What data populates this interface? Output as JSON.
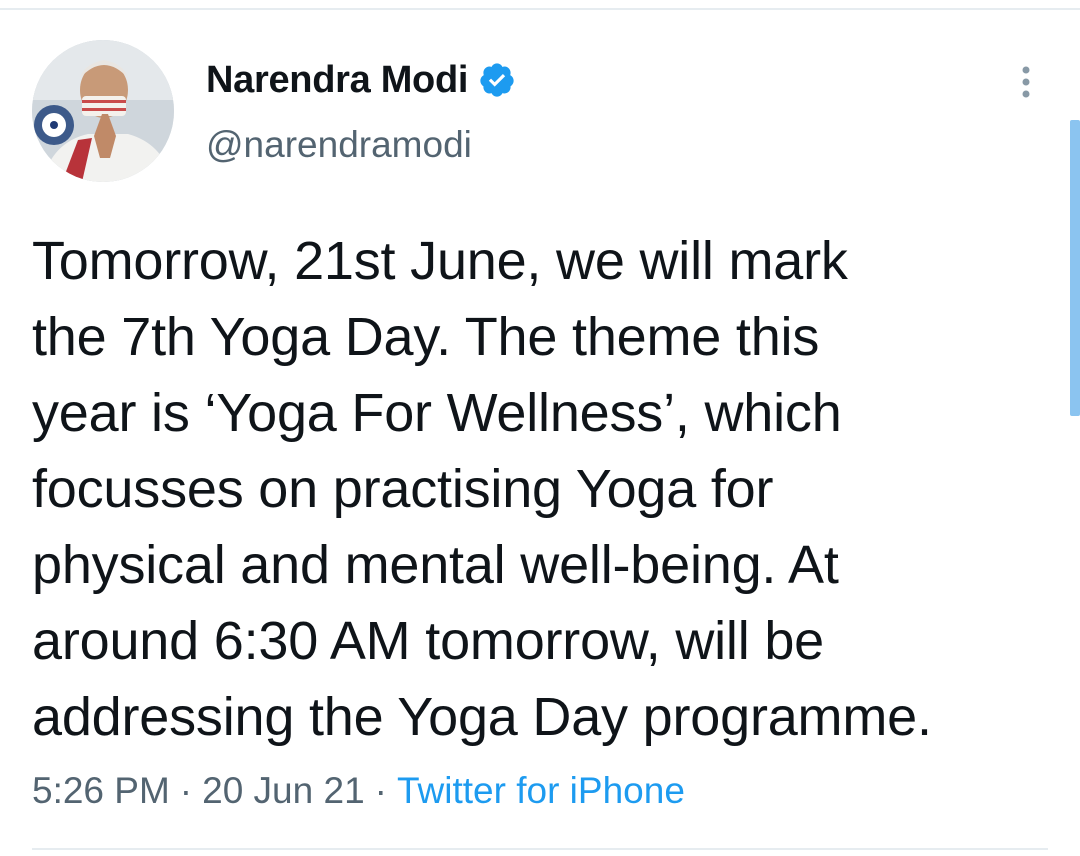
{
  "tweet": {
    "author": {
      "display_name": "Narendra Modi",
      "handle": "@narendramodi",
      "verified": true,
      "avatar_icon": "profile-photo"
    },
    "text": "Tomorrow, 21st June, we will mark\nthe 7th Yoga Day. The theme this\nyear is ‘Yoga For Wellness’, which\nfocusses on practising Yoga for\nphysical and mental well-being. At\naround 6:30 AM tomorrow, will be\naddressing the Yoga Day programme.",
    "time": "5:26 PM",
    "date": "20 Jun 21",
    "separator": "·",
    "source": "Twitter for iPhone"
  },
  "icons": {
    "verified": "verified-badge-icon",
    "more": "more-vertical-icon"
  },
  "colors": {
    "link": "#1d9bf0",
    "secondary_text": "#536471",
    "primary_text": "#0f1419",
    "verified_badge": "#1d9bf0"
  }
}
